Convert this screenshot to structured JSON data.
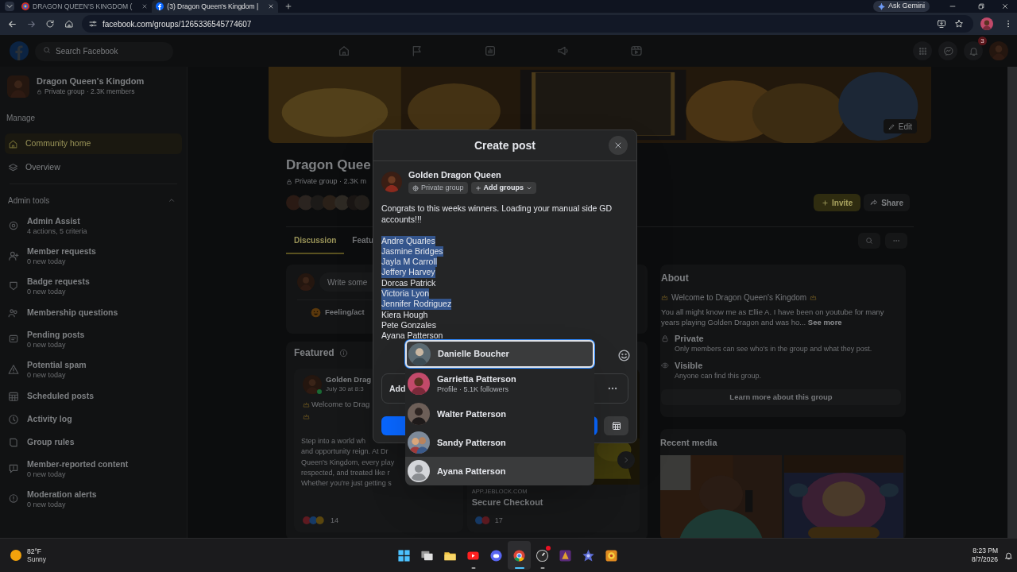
{
  "browser": {
    "tabs": [
      {
        "title": "DRAGON QUEEN'S KINGDOM (",
        "selected": false
      },
      {
        "title": "(3) Dragon Queen's Kingdom |",
        "selected": true
      }
    ],
    "ask_gemini": "Ask Gemini",
    "url": "facebook.com/groups/1265336545774607"
  },
  "header": {
    "search_placeholder": "Search Facebook",
    "notification_count": "3"
  },
  "sidebar": {
    "group_name": "Dragon Queen's Kingdom",
    "group_meta": "Private group · 2.3K members",
    "manage_heading": "Manage",
    "items": [
      {
        "kind": "home",
        "label": "Community home",
        "selected": true
      },
      {
        "kind": "overview",
        "label": "Overview",
        "selected": false
      }
    ],
    "admin_heading": "Admin tools",
    "admin_expanded": true,
    "admin_items": [
      {
        "kind": "assist",
        "label": "Admin Assist",
        "sub": "4 actions, 5 criteria"
      },
      {
        "kind": "requests",
        "label": "Member requests",
        "sub": "0 new today"
      },
      {
        "kind": "badge",
        "label": "Badge requests",
        "sub": "0 new today"
      },
      {
        "kind": "questions",
        "label": "Membership questions"
      },
      {
        "kind": "pending",
        "label": "Pending posts",
        "sub": "0 new today"
      },
      {
        "kind": "spam",
        "label": "Potential spam",
        "sub": "0 new today"
      },
      {
        "kind": "scheduled",
        "label": "Scheduled posts"
      },
      {
        "kind": "log",
        "label": "Activity log"
      },
      {
        "kind": "rules",
        "label": "Group rules"
      },
      {
        "kind": "reported",
        "label": "Member-reported content",
        "sub": "0 new today"
      },
      {
        "kind": "alerts",
        "label": "Moderation alerts",
        "sub": "0 new today"
      }
    ]
  },
  "group": {
    "title": "Dragon Quee",
    "meta": "Private group · 2.3K m",
    "edit": "Edit",
    "invite": "Invite",
    "share": "Share",
    "tabs": [
      {
        "label": "Discussion",
        "selected": true
      },
      {
        "label": "Featu",
        "selected": false
      }
    ],
    "composer_placeholder": "Write some",
    "feeling": "Feeling/act",
    "featured_heading": "Featured",
    "featured_post": {
      "author": "Golden Drag",
      "time": "July 30 at 8:3",
      "welcome": "Welcome to Drag",
      "body_lines": [
        "Step into a world wh",
        "and opportunity reign. At Dr",
        "Queen's Kingdom, every play",
        "respected, and treated like r",
        "Whether you're just getting s"
      ],
      "reactions": "14"
    },
    "featured_link": {
      "source": "APP.JEBLOCK.COM",
      "title": "Secure Checkout",
      "reactions": "17"
    }
  },
  "about": {
    "heading": "About",
    "welcome": "Welcome to Dragon Queen's Kingdom",
    "description": "You all might know me as Ellie A. I have been on youtube for many years playing Golden Dragon and was ho...",
    "see_more": "See more",
    "privacy_title": "Private",
    "privacy_text": "Only members can see who's in the group and what they post.",
    "visibility_title": "Visible",
    "visibility_text": "Anyone can find this group.",
    "learn_more": "Learn more about this group"
  },
  "recent_media": {
    "heading": "Recent media"
  },
  "create_post": {
    "title": "Create post",
    "author": "Golden Dragon Queen",
    "audience": "Private group",
    "add_groups": "Add groups",
    "intro": "Congrats to this weeks winners. Loading your manual side GD accounts!!!",
    "names": [
      {
        "text": "Andre Quarles",
        "selected": true
      },
      {
        "text": "Jasmine Bridges",
        "selected": true
      },
      {
        "text": "Jayla M Carroll",
        "selected": true
      },
      {
        "text": "Jeffery Harvey",
        "selected": true
      },
      {
        "text": "Dorcas Patrick",
        "selected": false
      },
      {
        "text": "Victoria Lyon",
        "selected": true
      },
      {
        "text": "Jennifer Rodriguez",
        "selected": true
      },
      {
        "text": "Kiera Hough",
        "selected": false
      },
      {
        "text": "Pete Gonzales",
        "selected": false
      },
      {
        "text": "Ayana Patterson",
        "selected": false
      }
    ],
    "add_to_post": "Add"
  },
  "mention": {
    "query": "Danielle Boucher",
    "suggestions": [
      {
        "name": "Garrietta Patterson",
        "detail": "Profile · 5.1K followers",
        "photo": true,
        "hovered": false
      },
      {
        "name": "Walter Patterson",
        "photo": true,
        "hovered": false
      },
      {
        "name": "Sandy Patterson",
        "photo": true,
        "hovered": false
      },
      {
        "name": "Ayana Patterson",
        "photo": false,
        "hovered": true
      }
    ]
  },
  "taskbar": {
    "temperature": "82°F",
    "condition": "Sunny",
    "apps": [
      {
        "kind": "start",
        "open": false,
        "active": false,
        "alert": false
      },
      {
        "kind": "task-view",
        "open": false,
        "active": false,
        "alert": false
      },
      {
        "kind": "folder",
        "open": false,
        "active": false,
        "alert": false
      },
      {
        "kind": "video",
        "open": true,
        "active": false,
        "alert": false
      },
      {
        "kind": "chat",
        "open": false,
        "active": false,
        "alert": false
      },
      {
        "kind": "browser",
        "open": true,
        "active": true,
        "alert": false
      },
      {
        "kind": "gauge",
        "open": true,
        "active": false,
        "alert": true
      },
      {
        "kind": "game-purple",
        "open": false,
        "active": false,
        "alert": false
      },
      {
        "kind": "game-blue",
        "open": false,
        "active": false,
        "alert": false
      },
      {
        "kind": "game-orange",
        "open": false,
        "active": false,
        "alert": false
      }
    ],
    "time": "8:23 PM",
    "date": "8/7/2026"
  }
}
